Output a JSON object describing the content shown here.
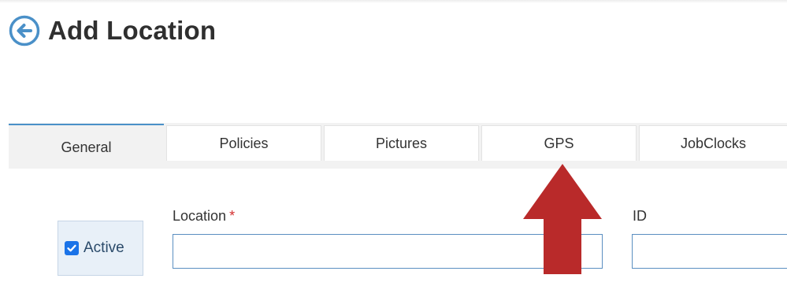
{
  "header": {
    "title": "Add Location"
  },
  "tabs": [
    {
      "label": "General",
      "active": true
    },
    {
      "label": "Policies",
      "active": false
    },
    {
      "label": "Pictures",
      "active": false
    },
    {
      "label": "GPS",
      "active": false
    },
    {
      "label": "JobClocks",
      "active": false
    }
  ],
  "form": {
    "active_label": "Active",
    "active_checked": true,
    "location_label": "Location",
    "required_marker": "*",
    "location_value": "",
    "id_label": "ID",
    "id_value": ""
  },
  "colors": {
    "accent": "#4a90c8",
    "checkbox": "#1a73e8",
    "annotation_arrow": "#b92a2a"
  },
  "annotation": {
    "icon": "up-arrow-icon",
    "points_to": "GPS"
  }
}
